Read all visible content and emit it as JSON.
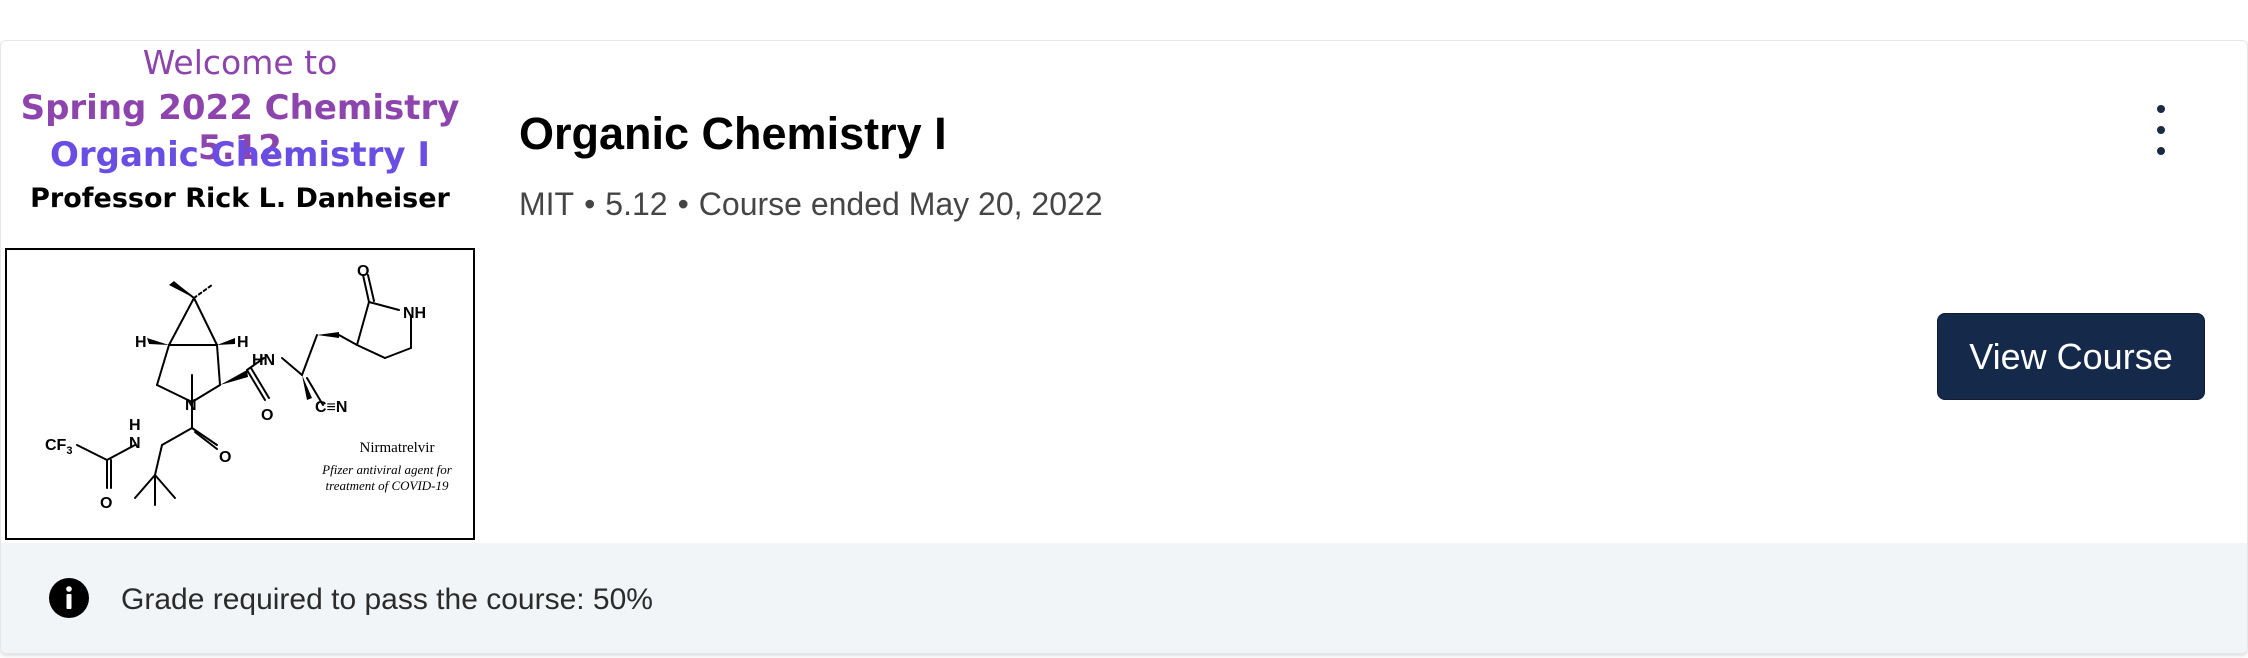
{
  "course": {
    "title": "Organic Chemistry I",
    "org": "MIT",
    "number": "5.12",
    "status": "Course ended May 20, 2022",
    "separator": "•",
    "view_label": "View Course"
  },
  "thumbnail": {
    "line1": "Welcome to",
    "line2": "Spring 2022  Chemistry 5.12",
    "line3": "Organic Chemistry I",
    "line4": "Professor Rick L. Danheiser",
    "molecule_name": "Nirmatrelvir",
    "molecule_desc_1": "Pfizer antiviral agent for",
    "molecule_desc_2": "treatment of COVID-19",
    "atom_labels": {
      "o_top": "O",
      "nh_ring": "NH",
      "h_left": "H",
      "h_right": "H",
      "hn": "HN",
      "cn": "C≡N",
      "n_ring": "N",
      "o_amide1": "O",
      "cf3": "CF",
      "cf3_sub": "3",
      "h_n": "H",
      "n_amide": "N",
      "o_tfa": "O",
      "o_amide2": "O"
    }
  },
  "footer": {
    "grade_text": "Grade required to pass the course: 50%"
  },
  "colors": {
    "button_bg": "#15294a",
    "welcome_purple": "#8e44ad",
    "course_blue": "#6a4de3",
    "footer_bg": "#f1f5f8"
  },
  "icons": {
    "menu": "kebab-vertical-icon",
    "info": "info-circle-icon"
  }
}
